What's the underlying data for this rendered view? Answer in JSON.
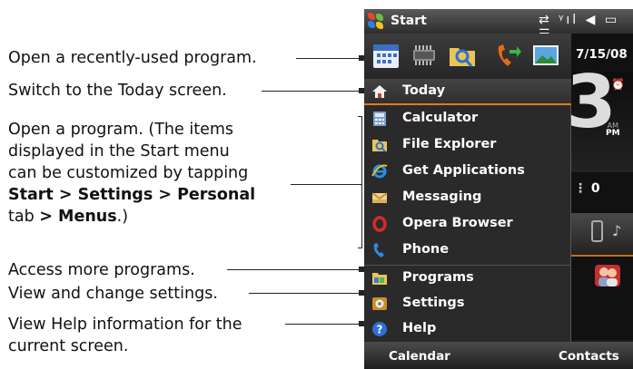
{
  "callouts": {
    "recent": "Open a recently-used program.",
    "today": "Switch to the Today screen.",
    "program_line1": "Open a program. (The items",
    "program_line2": "displayed in the Start menu",
    "program_line3": "can be customized by tapping",
    "program_line4_start": "Start",
    "program_line4_sep1": " > ",
    "program_line4_settings": "Settings",
    "program_line4_sep2": " > ",
    "program_line4_personal": "Personal",
    "program_line5_tab": "tab ",
    "program_line5_gt": "> ",
    "program_line5_menus": "Menus",
    "program_line5_end": ".)",
    "more": "Access more programs.",
    "settings": "View and change settings.",
    "help_line1": "View Help information for the",
    "help_line2": "current screen."
  },
  "titlebar": {
    "title": "Start",
    "status_icons": "⇄ ᵞıl ◀ ▭ ☰"
  },
  "today": {
    "date": "7/15/08",
    "clock_digit": "3",
    "am": "AM",
    "pm": "PM",
    "missed_count": "0"
  },
  "menu": {
    "items": [
      {
        "label": "Today",
        "icon": "home-icon"
      },
      {
        "label": "Calculator",
        "icon": "calculator-icon"
      },
      {
        "label": "File Explorer",
        "icon": "file-explorer-icon"
      },
      {
        "label": "Get Applications",
        "icon": "internet-explorer-icon"
      },
      {
        "label": "Messaging",
        "icon": "messaging-icon"
      },
      {
        "label": "Opera Browser",
        "icon": "opera-icon"
      },
      {
        "label": "Phone",
        "icon": "phone-icon"
      },
      {
        "label": "Programs",
        "icon": "programs-folder-icon"
      },
      {
        "label": "Settings",
        "icon": "settings-icon"
      },
      {
        "label": "Help",
        "icon": "help-icon"
      }
    ],
    "recent_icons": [
      "calendar-icon",
      "chip-icon",
      "search-folder-icon",
      "phone-forward-icon",
      "pictures-icon"
    ]
  },
  "softkeys": {
    "left": "Calendar",
    "right": "Contacts"
  },
  "colors": {
    "accent": "#e07a1c",
    "screen_bg": "#1c1c1c"
  }
}
